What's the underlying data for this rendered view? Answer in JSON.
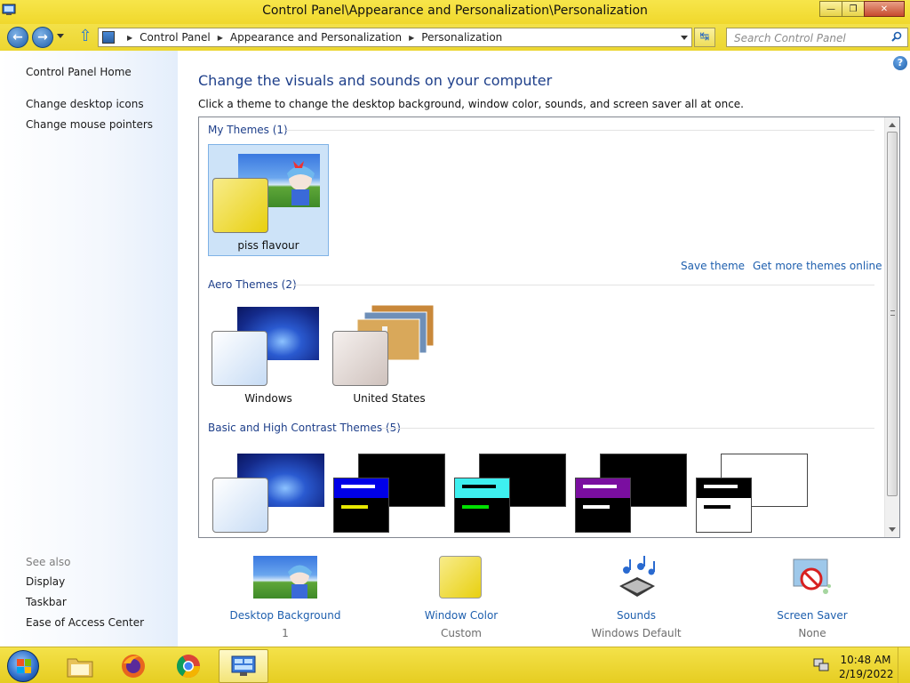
{
  "window": {
    "title": "Control Panel\\Appearance and Personalization\\Personalization",
    "controls": [
      "minimize",
      "maximize",
      "close"
    ]
  },
  "nav": {
    "breadcrumbs": [
      "Control Panel",
      "Appearance and Personalization",
      "Personalization"
    ],
    "search_placeholder": "Search Control Panel"
  },
  "sidebar": {
    "home": "Control Panel Home",
    "links": [
      "Change desktop icons",
      "Change mouse pointers"
    ],
    "see_also_label": "See also",
    "see_also": [
      "Display",
      "Taskbar",
      "Ease of Access Center"
    ]
  },
  "main": {
    "title": "Change the visuals and sounds on your computer",
    "subtitle": "Click a theme to change the desktop background, window color, sounds, and screen saver all at once.",
    "groups": [
      {
        "heading": "My Themes (1)",
        "themes": [
          {
            "name": "piss flavour",
            "selected": true
          }
        ]
      },
      {
        "heading": "Aero Themes (2)",
        "themes": [
          {
            "name": "Windows"
          },
          {
            "name": "United States"
          }
        ]
      },
      {
        "heading": "Basic and High Contrast Themes (5)",
        "themes": []
      }
    ],
    "save_theme": "Save theme",
    "get_more": "Get more themes online"
  },
  "bottom": [
    {
      "label": "Desktop Background",
      "value": "1"
    },
    {
      "label": "Window Color",
      "value": "Custom"
    },
    {
      "label": "Sounds",
      "value": "Windows Default"
    },
    {
      "label": "Screen Saver",
      "value": "None"
    }
  ],
  "taskbar": {
    "time": "10:48 AM",
    "date": "2/19/2022",
    "pinned": [
      "file-explorer",
      "firefox",
      "chrome",
      "control-panel"
    ]
  },
  "colors": {
    "chrome_yellow": "#f0d82c",
    "link_blue": "#1e5fae",
    "heading_blue": "#1e3f8a",
    "selection": "#cde3f8"
  }
}
